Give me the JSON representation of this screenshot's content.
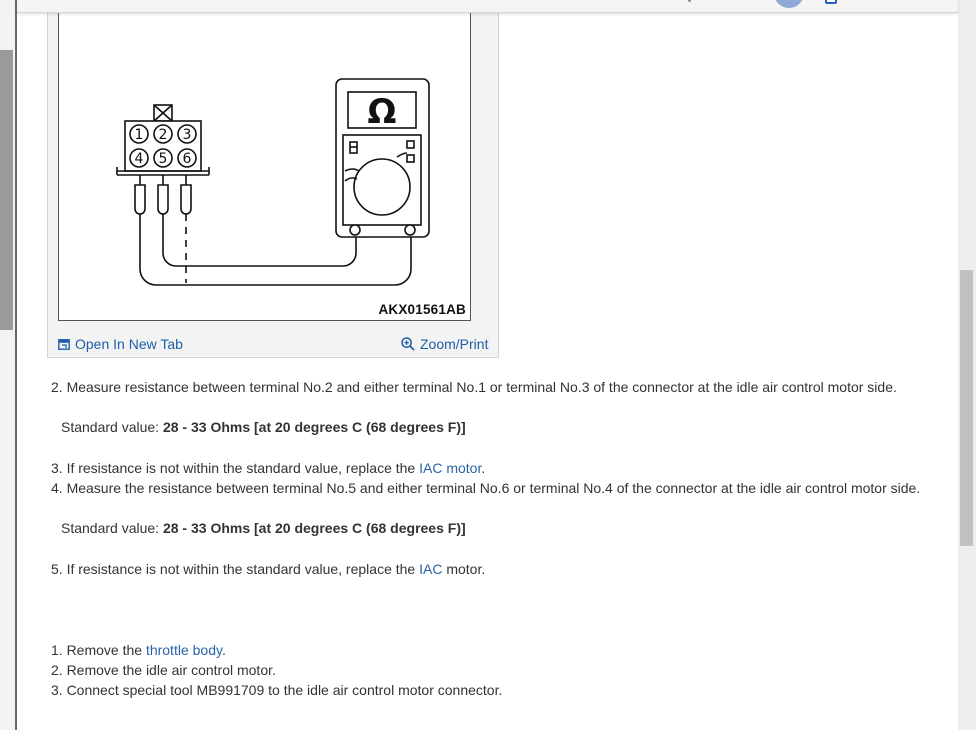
{
  "figure": {
    "code": "AKX01561AB",
    "meter_symbol": "Ω",
    "connector_pins": [
      "1",
      "2",
      "3",
      "4",
      "5",
      "6"
    ]
  },
  "card": {
    "open_label": "Open In New Tab",
    "zoom_label": "Zoom/Print"
  },
  "steps_a": {
    "s2": "2. Measure resistance between terminal No.2 and either terminal No.1 or terminal No.3 of the connector at the idle air control motor side.",
    "std1_label": "Standard value: ",
    "std1_value": "28 - 33 Ohms [at 20 degrees C (68 degrees F)]",
    "s3_prefix": "3. If resistance is not within the standard value, replace the ",
    "s3_link": "IAC motor",
    "s3_suffix": ".",
    "s4": "4. Measure the resistance between terminal No.5 and either terminal No.6 or terminal No.4 of the connector at the idle air control motor side.",
    "std2_label": "Standard value: ",
    "std2_value": "28 - 33 Ohms [at 20 degrees C (68 degrees F)]",
    "s5_prefix": "5. If resistance is not within the standard value, replace the ",
    "s5_link": "IAC",
    "s5_suffix": " motor."
  },
  "steps_b": {
    "s1_prefix": "1. Remove the ",
    "s1_link": "throttle body",
    "s1_suffix": ".",
    "s2": "2. Remove the idle air control motor.",
    "s3": "3. Connect special tool MB991709 to the idle air control motor connector."
  },
  "colors": {
    "link": "#2a63a8",
    "card_link": "#1f5fa8",
    "scroll_thumb": "#c1c1c1"
  }
}
